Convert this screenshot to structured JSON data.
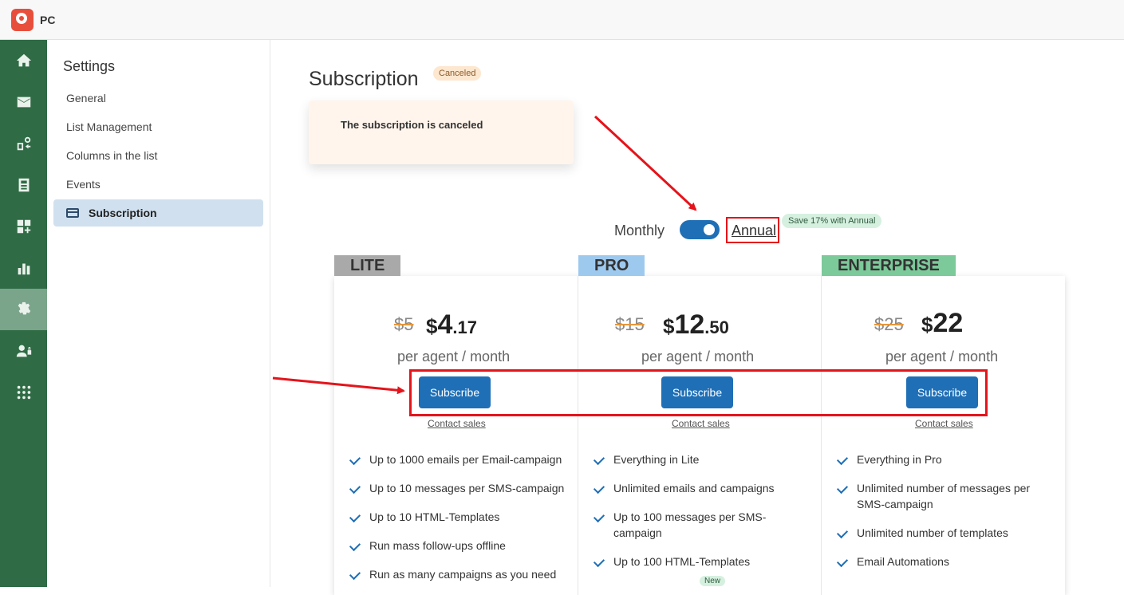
{
  "app": {
    "title": "PC"
  },
  "rail": {
    "items": [
      {
        "name": "home-icon"
      },
      {
        "name": "mail-icon"
      },
      {
        "name": "campaigns-icon"
      },
      {
        "name": "templates-icon"
      },
      {
        "name": "apps-add-icon"
      },
      {
        "name": "analytics-icon"
      },
      {
        "name": "gear-icon",
        "active": true
      },
      {
        "name": "users-icon"
      },
      {
        "name": "grid-icon"
      }
    ]
  },
  "settings": {
    "title": "Settings",
    "items": [
      {
        "label": "General"
      },
      {
        "label": "List Management"
      },
      {
        "label": "Columns in the list"
      },
      {
        "label": "Events"
      },
      {
        "label": "Subscription",
        "active": true
      }
    ]
  },
  "page": {
    "title": "Subscription",
    "status": "Canceled",
    "alert": "The subscription is canceled"
  },
  "billing": {
    "monthly": "Monthly",
    "annual": "Annual",
    "save": "Save 17% with Annual",
    "annual_selected": true
  },
  "plans": [
    {
      "name": "LITE",
      "tag_color": "#a9a9a9",
      "old_price": "$5",
      "currency": "$",
      "price_int": "4",
      "price_cents": ".17",
      "per": "per agent / month",
      "subscribe": "Subscribe",
      "contact": "Contact sales",
      "features": [
        "Up to 1000 emails per Email-campaign",
        "Up to 10 messages per SMS-campaign",
        "Up to 10 HTML-Templates",
        "Run mass follow-ups offline",
        "Run as many campaigns as you need"
      ]
    },
    {
      "name": "PRO",
      "tag_color": "#9ec9ef",
      "old_price": "$15",
      "currency": "$",
      "price_int": "12",
      "price_cents": ".50",
      "per": "per agent / month",
      "subscribe": "Subscribe",
      "contact": "Contact sales",
      "features": [
        "Everything in Lite",
        "Unlimited emails and campaigns",
        "Up to 100 messages per SMS-campaign",
        "Up to 100 HTML-Templates"
      ],
      "new_badge": "New"
    },
    {
      "name": "ENTERPRISE",
      "tag_color": "#7cc99a",
      "old_price": "$25",
      "currency": "$",
      "price_int": "22",
      "price_cents": "",
      "per": "per agent / month",
      "subscribe": "Subscribe",
      "contact": "Contact sales",
      "features": [
        "Everything in Pro",
        "Unlimited number of messages per SMS-campaign",
        "Unlimited number of templates",
        "Email Automations"
      ]
    }
  ]
}
